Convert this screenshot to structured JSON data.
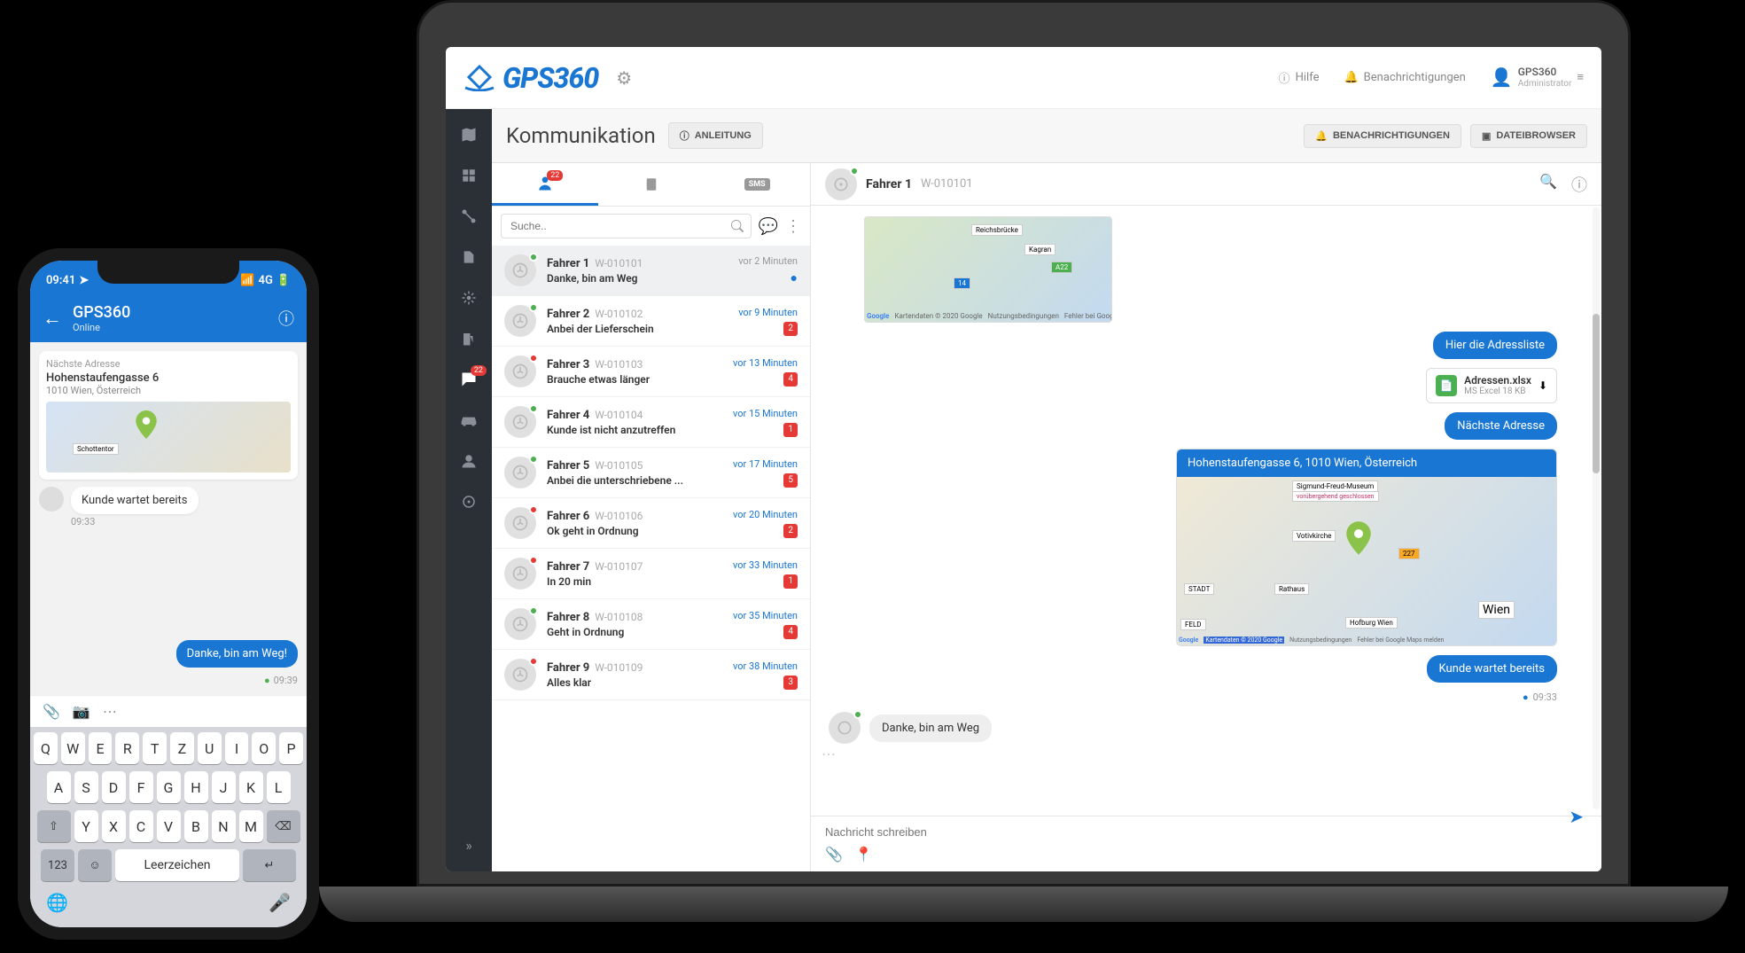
{
  "brand": "GPS360",
  "topbar": {
    "help": "Hilfe",
    "notifications": "Benachrichtigungen",
    "user_name": "GPS360",
    "user_role": "Administrator"
  },
  "nav": {
    "chat_badge": "22"
  },
  "page": {
    "title": "Kommunikation",
    "guide_btn": "ANLEITUNG",
    "notif_btn": "BENACHRICHTIGUNGEN",
    "files_btn": "DATEIBROWSER"
  },
  "conv_tabs": {
    "badge": "22",
    "sms": "SMS"
  },
  "search": {
    "placeholder": "Suche.."
  },
  "conversations": [
    {
      "name": "Fahrer 1",
      "id": "W-010101",
      "snippet": "Danke, bin am Weg",
      "time": "vor 2 Minuten",
      "status": "online",
      "selected": true,
      "read": true
    },
    {
      "name": "Fahrer 2",
      "id": "W-010102",
      "snippet": "Anbei der Lieferschein",
      "time": "vor 9 Minuten",
      "status": "online",
      "badge": "2"
    },
    {
      "name": "Fahrer 3",
      "id": "W-010103",
      "snippet": "Brauche etwas länger",
      "time": "vor 13 Minuten",
      "status": "offline",
      "badge": "4"
    },
    {
      "name": "Fahrer 4",
      "id": "W-010104",
      "snippet": "Kunde ist nicht anzutreffen",
      "time": "vor 15 Minuten",
      "status": "online",
      "badge": "1"
    },
    {
      "name": "Fahrer 5",
      "id": "W-010105",
      "snippet": "Anbei die unterschriebene ...",
      "time": "vor 17 Minuten",
      "status": "online",
      "badge": "5"
    },
    {
      "name": "Fahrer 6",
      "id": "W-010106",
      "snippet": "Ok geht in Ordnung",
      "time": "vor 20 Minuten",
      "status": "offline",
      "badge": "2"
    },
    {
      "name": "Fahrer 7",
      "id": "W-010107",
      "snippet": "In 20 min",
      "time": "vor 33 Minuten",
      "status": "offline",
      "badge": "1"
    },
    {
      "name": "Fahrer 8",
      "id": "W-010108",
      "snippet": "Geht in Ordnung",
      "time": "vor 35 Minuten",
      "status": "online",
      "badge": "4"
    },
    {
      "name": "Fahrer 9",
      "id": "W-010109",
      "snippet": "Alles klar",
      "time": "vor 38 Minuten",
      "status": "offline",
      "badge": "3"
    }
  ],
  "chat": {
    "title_name": "Fahrer 1",
    "title_id": "W-010101",
    "map_top": {
      "label1": "Reichsbrücke",
      "label2": "Kagran",
      "road": "A22",
      "hwy": "14",
      "attrib": "Google",
      "attrib2": "Kartendaten © 2020 Google",
      "attrib3": "Nutzungsbedingungen",
      "attrib4": "Fehler bei Google Maps melden"
    },
    "msg_addresslist": "Hier die Adressliste",
    "file": {
      "name": "Adressen.xlsx",
      "size": "MS Excel 18 KB"
    },
    "msg_nextaddr": "Nächste Adresse",
    "address_full": "Hohenstaufengasse 6, 1010 Wien, Österreich",
    "map_main": {
      "l1": "Sigmund-Freud-Museum",
      "l2": "vorübergehend geschlossen",
      "l3": "Votivkirche",
      "l4": "Rathaus",
      "l5": "Hofburg Wien",
      "l6": "Wien",
      "l7": "STADT",
      "l8": "FELD",
      "road": "227",
      "att1": "Google",
      "att2": "Kartendaten © 2020 Google",
      "att3": "Nutzungsbedingungen",
      "att4": "Fehler bei Google Maps melden"
    },
    "msg_waiting": "Kunde wartet bereits",
    "msg_time": "09:33",
    "typing": "Danke, bin am Weg",
    "composer_placeholder": "Nachricht schreiben"
  },
  "phone": {
    "status_time": "09:41",
    "status_net": "4G",
    "title": "GPS360",
    "subtitle": "Online",
    "card_label": "Nächste Adresse",
    "card_addr": "Hohenstaufengasse 6",
    "card_city": "1010 Wien, Österreich",
    "map_label": "Schottentor",
    "msg_in": "Kunde wartet bereits",
    "msg_in_time": "09:33",
    "msg_out": "Danke, bin am Weg!",
    "msg_out_time": "09:39",
    "keys_r1": [
      "Q",
      "W",
      "E",
      "R",
      "T",
      "Z",
      "U",
      "I",
      "O",
      "P"
    ],
    "keys_r2": [
      "A",
      "S",
      "D",
      "F",
      "G",
      "H",
      "J",
      "K",
      "L"
    ],
    "keys_r3": [
      "Y",
      "X",
      "C",
      "V",
      "B",
      "N",
      "M"
    ],
    "key_123": "123",
    "key_space": "Leerzeichen"
  }
}
